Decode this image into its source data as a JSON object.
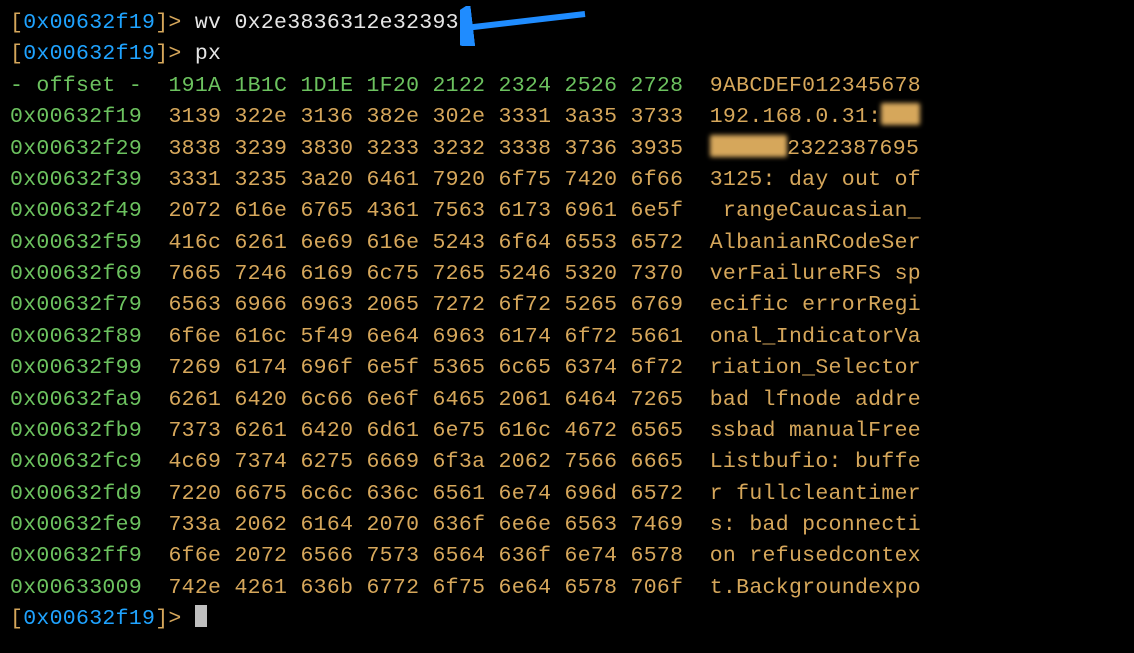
{
  "prompt_address": "0x00632f19",
  "commands": {
    "wv": {
      "name": "wv",
      "arg": "0x2e3836312e323931"
    },
    "px": {
      "name": "px"
    }
  },
  "header": {
    "offset_label": "- offset -",
    "cols": [
      "191A",
      "1B1C",
      "1D1E",
      "1F20",
      "2122",
      "2324",
      "2526",
      "2728"
    ],
    "ascii_label": "9ABCDEF012345678"
  },
  "rows": [
    {
      "offset": "0x00632f19",
      "hex": [
        "3139",
        "322e",
        "3136",
        "382e",
        "302e",
        "3331",
        "3a35",
        "3733"
      ],
      "ascii_pre": "192.168.0.31:",
      "redact_ch": 3,
      "ascii_post": ""
    },
    {
      "offset": "0x00632f29",
      "hex": [
        "3838",
        "3239",
        "3830",
        "3233",
        "3232",
        "3338",
        "3736",
        "3935"
      ],
      "ascii_pre": "",
      "redact_ch": 6,
      "ascii_post": "2322387695"
    },
    {
      "offset": "0x00632f39",
      "hex": [
        "3331",
        "3235",
        "3a20",
        "6461",
        "7920",
        "6f75",
        "7420",
        "6f66"
      ],
      "ascii": "3125: day out of"
    },
    {
      "offset": "0x00632f49",
      "hex": [
        "2072",
        "616e",
        "6765",
        "4361",
        "7563",
        "6173",
        "6961",
        "6e5f"
      ],
      "ascii": " rangeCaucasian_"
    },
    {
      "offset": "0x00632f59",
      "hex": [
        "416c",
        "6261",
        "6e69",
        "616e",
        "5243",
        "6f64",
        "6553",
        "6572"
      ],
      "ascii": "AlbanianRCodeSer"
    },
    {
      "offset": "0x00632f69",
      "hex": [
        "7665",
        "7246",
        "6169",
        "6c75",
        "7265",
        "5246",
        "5320",
        "7370"
      ],
      "ascii": "verFailureRFS sp"
    },
    {
      "offset": "0x00632f79",
      "hex": [
        "6563",
        "6966",
        "6963",
        "2065",
        "7272",
        "6f72",
        "5265",
        "6769"
      ],
      "ascii": "ecific errorRegi"
    },
    {
      "offset": "0x00632f89",
      "hex": [
        "6f6e",
        "616c",
        "5f49",
        "6e64",
        "6963",
        "6174",
        "6f72",
        "5661"
      ],
      "ascii": "onal_IndicatorVa"
    },
    {
      "offset": "0x00632f99",
      "hex": [
        "7269",
        "6174",
        "696f",
        "6e5f",
        "5365",
        "6c65",
        "6374",
        "6f72"
      ],
      "ascii": "riation_Selector"
    },
    {
      "offset": "0x00632fa9",
      "hex": [
        "6261",
        "6420",
        "6c66",
        "6e6f",
        "6465",
        "2061",
        "6464",
        "7265"
      ],
      "ascii": "bad lfnode addre"
    },
    {
      "offset": "0x00632fb9",
      "hex": [
        "7373",
        "6261",
        "6420",
        "6d61",
        "6e75",
        "616c",
        "4672",
        "6565"
      ],
      "ascii": "ssbad manualFree"
    },
    {
      "offset": "0x00632fc9",
      "hex": [
        "4c69",
        "7374",
        "6275",
        "6669",
        "6f3a",
        "2062",
        "7566",
        "6665"
      ],
      "ascii": "Listbufio: buffe"
    },
    {
      "offset": "0x00632fd9",
      "hex": [
        "7220",
        "6675",
        "6c6c",
        "636c",
        "6561",
        "6e74",
        "696d",
        "6572"
      ],
      "ascii": "r fullcleantimer"
    },
    {
      "offset": "0x00632fe9",
      "hex": [
        "733a",
        "2062",
        "6164",
        "2070",
        "636f",
        "6e6e",
        "6563",
        "7469"
      ],
      "ascii": "s: bad pconnecti"
    },
    {
      "offset": "0x00632ff9",
      "hex": [
        "6f6e",
        "2072",
        "6566",
        "7573",
        "6564",
        "636f",
        "6e74",
        "6578"
      ],
      "ascii": "on refusedcontex"
    },
    {
      "offset": "0x00633009",
      "hex": [
        "742e",
        "4261",
        "636b",
        "6772",
        "6f75",
        "6e64",
        "6578",
        "706f"
      ],
      "ascii": "t.Backgroundexpo"
    }
  ],
  "annotation": {
    "arrow_color": "#1f8cff"
  }
}
